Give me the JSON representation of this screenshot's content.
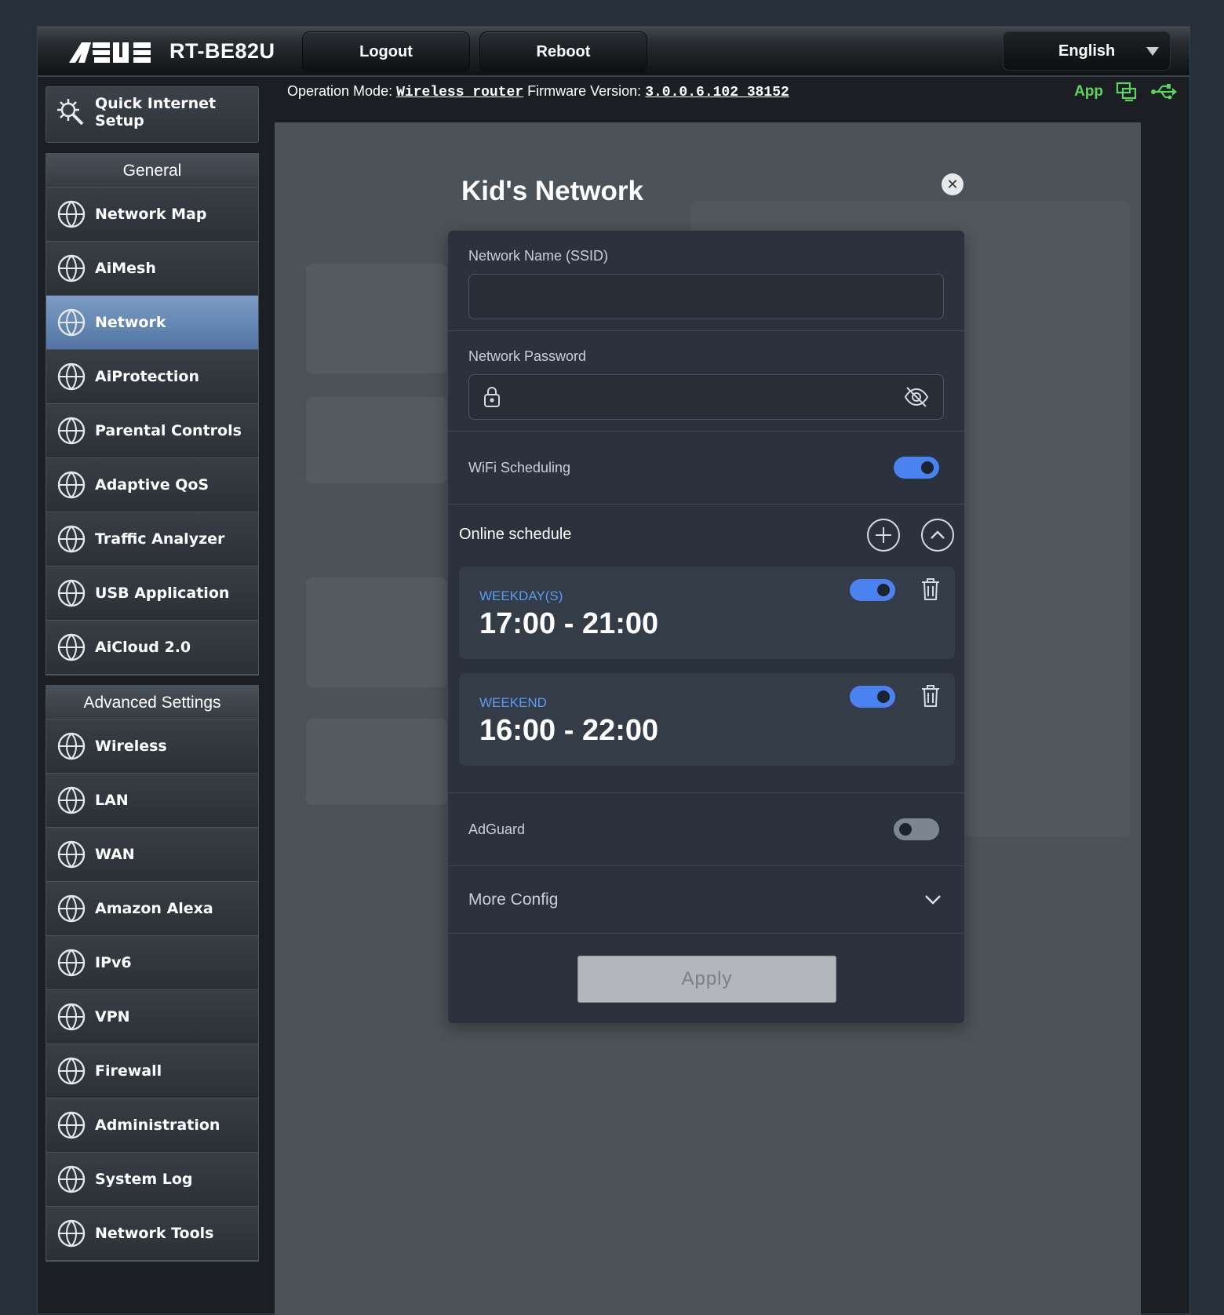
{
  "header": {
    "brand": "ASUS",
    "model": "RT-BE82U",
    "logout_label": "Logout",
    "reboot_label": "Reboot",
    "language": "English"
  },
  "status": {
    "op_mode_label": "Operation Mode:",
    "op_mode_value": "Wireless router",
    "firmware_label": "Firmware Version:",
    "firmware_value": "3.0.0.6.102_38152",
    "app_label": "App"
  },
  "sidebar": {
    "quick_setup": "Quick Internet Setup",
    "general_title": "General",
    "general_items": [
      {
        "label": "Network Map",
        "icon": "network-map-icon"
      },
      {
        "label": "AiMesh",
        "icon": "aimesh-icon"
      },
      {
        "label": "Network",
        "icon": "network-icon",
        "active": true
      },
      {
        "label": "AiProtection",
        "icon": "aiprotection-icon"
      },
      {
        "label": "Parental Controls",
        "icon": "parental-controls-icon"
      },
      {
        "label": "Adaptive QoS",
        "icon": "qos-gauge-icon"
      },
      {
        "label": "Traffic Analyzer",
        "icon": "traffic-analyzer-icon"
      },
      {
        "label": "USB Application",
        "icon": "usb-icon"
      },
      {
        "label": "AiCloud 2.0",
        "icon": "cloud-icon"
      }
    ],
    "advanced_title": "Advanced Settings",
    "advanced_items": [
      {
        "label": "Wireless",
        "icon": "wireless-icon"
      },
      {
        "label": "LAN",
        "icon": "lan-icon"
      },
      {
        "label": "WAN",
        "icon": "wan-globe-icon"
      },
      {
        "label": "Amazon Alexa",
        "icon": "alexa-icon"
      },
      {
        "label": "IPv6",
        "icon": "ipv6-icon"
      },
      {
        "label": "VPN",
        "icon": "vpn-icon"
      },
      {
        "label": "Firewall",
        "icon": "firewall-icon"
      },
      {
        "label": "Administration",
        "icon": "administration-gear-icon"
      },
      {
        "label": "System Log",
        "icon": "system-log-icon"
      },
      {
        "label": "Network Tools",
        "icon": "network-tools-icon"
      }
    ]
  },
  "modal": {
    "title": "Kid's Network",
    "ssid_label": "Network Name (SSID)",
    "ssid_value": "",
    "password_label": "Network Password",
    "password_value": "",
    "wifi_scheduling_label": "WiFi Scheduling",
    "wifi_scheduling_on": true,
    "schedule_title": "Online schedule",
    "schedules": [
      {
        "days": "WEEKDAY(S)",
        "time": "17:00 - 21:00",
        "enabled": true
      },
      {
        "days": "WEEKEND",
        "time": "16:00 - 22:00",
        "enabled": true
      }
    ],
    "adguard_label": "AdGuard",
    "adguard_on": false,
    "more_config_label": "More Config",
    "apply_label": "Apply"
  },
  "colors": {
    "accent": "#4a83ef",
    "schedule_day": "#5b9cf2",
    "app_green": "#5fd35f",
    "active_menu": "#5275a3"
  }
}
